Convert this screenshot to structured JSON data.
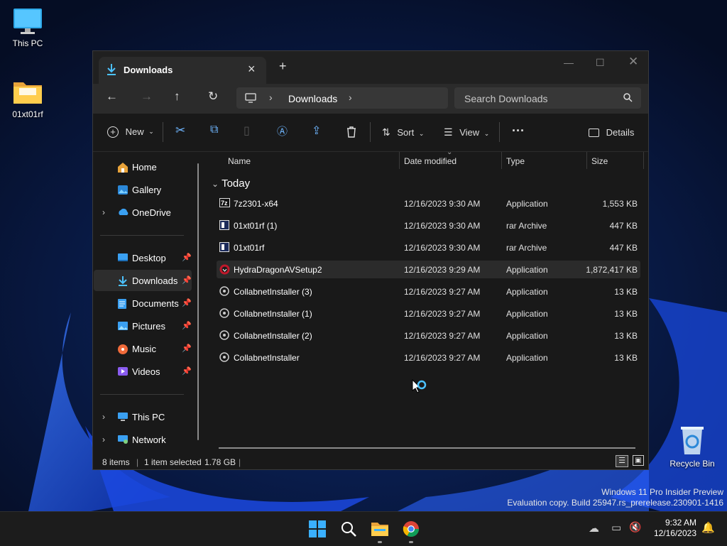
{
  "desktop": {
    "icons": [
      {
        "label": "This PC"
      },
      {
        "label": "01xt01rf"
      },
      {
        "label": "Recycle Bin"
      }
    ],
    "watermark": {
      "line1": "Windows 11 Pro Insider Preview",
      "line2": "Evaluation copy. Build 25947.rs_prerelease.230901-1416"
    }
  },
  "window": {
    "tab_title": "Downloads",
    "address": {
      "location": "Downloads"
    },
    "search": {
      "placeholder": "Search Downloads"
    },
    "commands": {
      "new_label": "New",
      "sort_label": "Sort",
      "view_label": "View",
      "details_label": "Details"
    },
    "sidebar": {
      "items": [
        {
          "label": "Home",
          "icon": "home-icon"
        },
        {
          "label": "Gallery",
          "icon": "gallery-icon"
        },
        {
          "label": "OneDrive",
          "icon": "onedrive-icon"
        },
        {
          "label": "Desktop",
          "icon": "desktop-folder-icon"
        },
        {
          "label": "Downloads",
          "icon": "downloads-folder-icon"
        },
        {
          "label": "Documents",
          "icon": "documents-folder-icon"
        },
        {
          "label": "Pictures",
          "icon": "pictures-folder-icon"
        },
        {
          "label": "Music",
          "icon": "music-folder-icon"
        },
        {
          "label": "Videos",
          "icon": "videos-folder-icon"
        },
        {
          "label": "This PC",
          "icon": "this-pc-icon"
        },
        {
          "label": "Network",
          "icon": "network-icon"
        }
      ]
    },
    "columns": {
      "name": "Name",
      "date": "Date modified",
      "type": "Type",
      "size": "Size"
    },
    "group_label": "Today",
    "files": [
      {
        "name": "7z2301-x64",
        "date": "12/16/2023 9:30 AM",
        "type": "Application",
        "size": "1,553 KB"
      },
      {
        "name": "01xt01rf (1)",
        "date": "12/16/2023 9:30 AM",
        "type": "rar Archive",
        "size": "447 KB"
      },
      {
        "name": "01xt01rf",
        "date": "12/16/2023 9:30 AM",
        "type": "rar Archive",
        "size": "447 KB"
      },
      {
        "name": "HydraDragonAVSetup2",
        "date": "12/16/2023 9:29 AM",
        "type": "Application",
        "size": "1,872,417 KB"
      },
      {
        "name": "CollabnetInstaller (3)",
        "date": "12/16/2023 9:27 AM",
        "type": "Application",
        "size": "13 KB"
      },
      {
        "name": "CollabnetInstaller (1)",
        "date": "12/16/2023 9:27 AM",
        "type": "Application",
        "size": "13 KB"
      },
      {
        "name": "CollabnetInstaller (2)",
        "date": "12/16/2023 9:27 AM",
        "type": "Application",
        "size": "13 KB"
      },
      {
        "name": "CollabnetInstaller",
        "date": "12/16/2023 9:27 AM",
        "type": "Application",
        "size": "13 KB"
      }
    ],
    "status": {
      "count": "8 items",
      "selection": "1 item selected",
      "selection_size": "1.78 GB"
    }
  },
  "taskbar": {
    "time": "9:32 AM",
    "date": "12/16/2023"
  },
  "colors": {
    "accent": "#4cc2ff",
    "window_bg": "#191919",
    "toolbar_bg": "#2b2b2b"
  }
}
